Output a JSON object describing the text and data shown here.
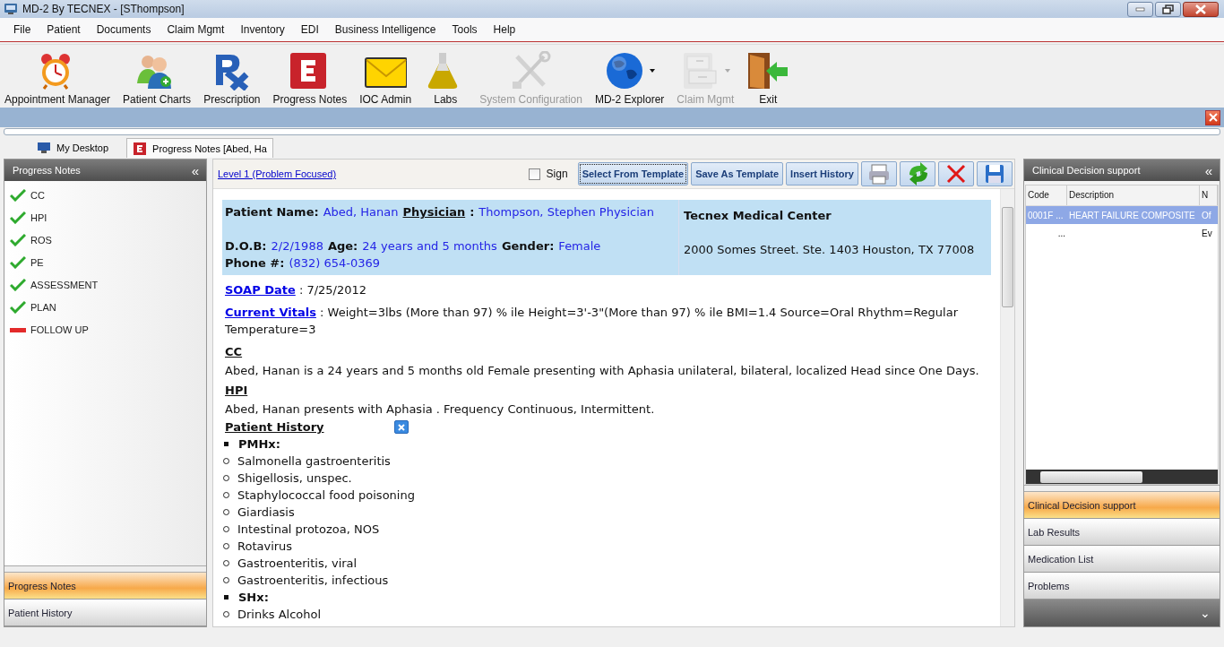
{
  "window": {
    "title": "MD-2 By TECNEX - [SThompson]"
  },
  "menu": [
    "File",
    "Patient",
    "Documents",
    "Claim Mgmt",
    "Inventory",
    "EDI",
    "Business Intelligence",
    "Tools",
    "Help"
  ],
  "toolbar": [
    {
      "label": "Appointment Manager",
      "disabled": false,
      "dropdown": false
    },
    {
      "label": "Patient Charts",
      "disabled": false,
      "dropdown": false
    },
    {
      "label": "Prescription",
      "disabled": false,
      "dropdown": false
    },
    {
      "label": "Progress Notes",
      "disabled": false,
      "dropdown": false
    },
    {
      "label": "IOC Admin",
      "disabled": false,
      "dropdown": false
    },
    {
      "label": "Labs",
      "disabled": false,
      "dropdown": false
    },
    {
      "label": "System Configuration",
      "disabled": true,
      "dropdown": false
    },
    {
      "label": "MD-2 Explorer",
      "disabled": false,
      "dropdown": true
    },
    {
      "label": "Claim Mgmt",
      "disabled": true,
      "dropdown": true
    },
    {
      "label": "Exit",
      "disabled": false,
      "dropdown": false
    }
  ],
  "doc_tabs": [
    {
      "label": "My Desktop",
      "selected": false
    },
    {
      "label": "Progress Notes [Abed, Ha",
      "selected": true
    }
  ],
  "left_panel": {
    "title": "Progress Notes",
    "collapse": "«",
    "items": [
      {
        "label": "CC",
        "done": true
      },
      {
        "label": "HPI",
        "done": true
      },
      {
        "label": "ROS",
        "done": true
      },
      {
        "label": "PE",
        "done": true
      },
      {
        "label": "ASSESSMENT",
        "done": true
      },
      {
        "label": "PLAN",
        "done": true
      },
      {
        "label": "FOLLOW UP",
        "done": false
      }
    ],
    "nav": [
      {
        "label": "Progress Notes",
        "selected": true
      },
      {
        "label": "Patient History",
        "selected": false
      }
    ]
  },
  "note": {
    "level_link": "Level 1 (Problem Focused)",
    "sign": {
      "label": "Sign",
      "checked": false
    },
    "buttons": [
      "Select From Template",
      "Save As Template",
      "Insert History"
    ],
    "patient": {
      "rows": [
        [
          {
            "label": "Patient Name:",
            "value": "Abed, Hanan"
          },
          {
            "label": "Physician",
            "underline": true,
            "sep": ":",
            "value": "Thompson, Stephen Physician"
          }
        ],
        [
          {
            "label": "D.O.B:",
            "value": "2/2/1988"
          },
          {
            "label": "Age:",
            "value": "24 years and 5 months"
          },
          {
            "label": "Gender:",
            "value": "Female"
          },
          {
            "label": "Phone #:",
            "value": "(832) 654-0369"
          }
        ]
      ],
      "clinic": "Tecnex Medical Center",
      "address": "2000 Somes Street. Ste. 1403 Houston, TX 77008"
    },
    "sections": [
      {
        "kind": "inline",
        "heading": "SOAP Date",
        "text": ": 7/25/2012"
      },
      {
        "kind": "inline",
        "heading": "Current Vitals",
        "text": ": Weight=3lbs (More than 97) % ile Height=3'-3\"(More than 97) % ile BMI=1.4 Source=Oral Rhythm=Regular Temperature=3"
      },
      {
        "kind": "block",
        "heading": "CC",
        "text": "Abed, Hanan is a 24 years and 5 months old Female presenting with Aphasia unilateral, bilateral, localized Head since One Days."
      },
      {
        "kind": "block",
        "heading": "HPI",
        "text": "Abed, Hanan presents with Aphasia . Frequency Continuous, Intermittent."
      },
      {
        "kind": "history",
        "heading": "Patient History",
        "groups": [
          {
            "title": "PMHx:",
            "items": [
              "Salmonella gastroenteritis",
              "Shigellosis, unspec.",
              "Staphylococcal food poisoning",
              "Giardiasis",
              "Intestinal protozoa, NOS",
              "Rotavirus",
              "Gastroenteritis, viral",
              "Gastroenteritis, infectious"
            ]
          },
          {
            "title": "SHx:",
            "items": [
              "Drinks Alcohol"
            ]
          }
        ]
      }
    ]
  },
  "right_panel": {
    "title": "Clinical Decision support",
    "collapse": "«",
    "columns": [
      "Code",
      "Description",
      "N"
    ],
    "rows": [
      {
        "cells": [
          "0001F ...",
          "HEART FAILURE COMPOSITE",
          "Of"
        ],
        "selected": true
      },
      {
        "cells": [
          "...",
          "",
          "Ev"
        ],
        "selected": false
      }
    ],
    "nav": [
      {
        "label": "Clinical Decision support",
        "selected": true
      },
      {
        "label": "Lab Results",
        "selected": false
      },
      {
        "label": "Medication List",
        "selected": false
      },
      {
        "label": "Problems",
        "selected": false
      }
    ],
    "more": "⌄"
  }
}
